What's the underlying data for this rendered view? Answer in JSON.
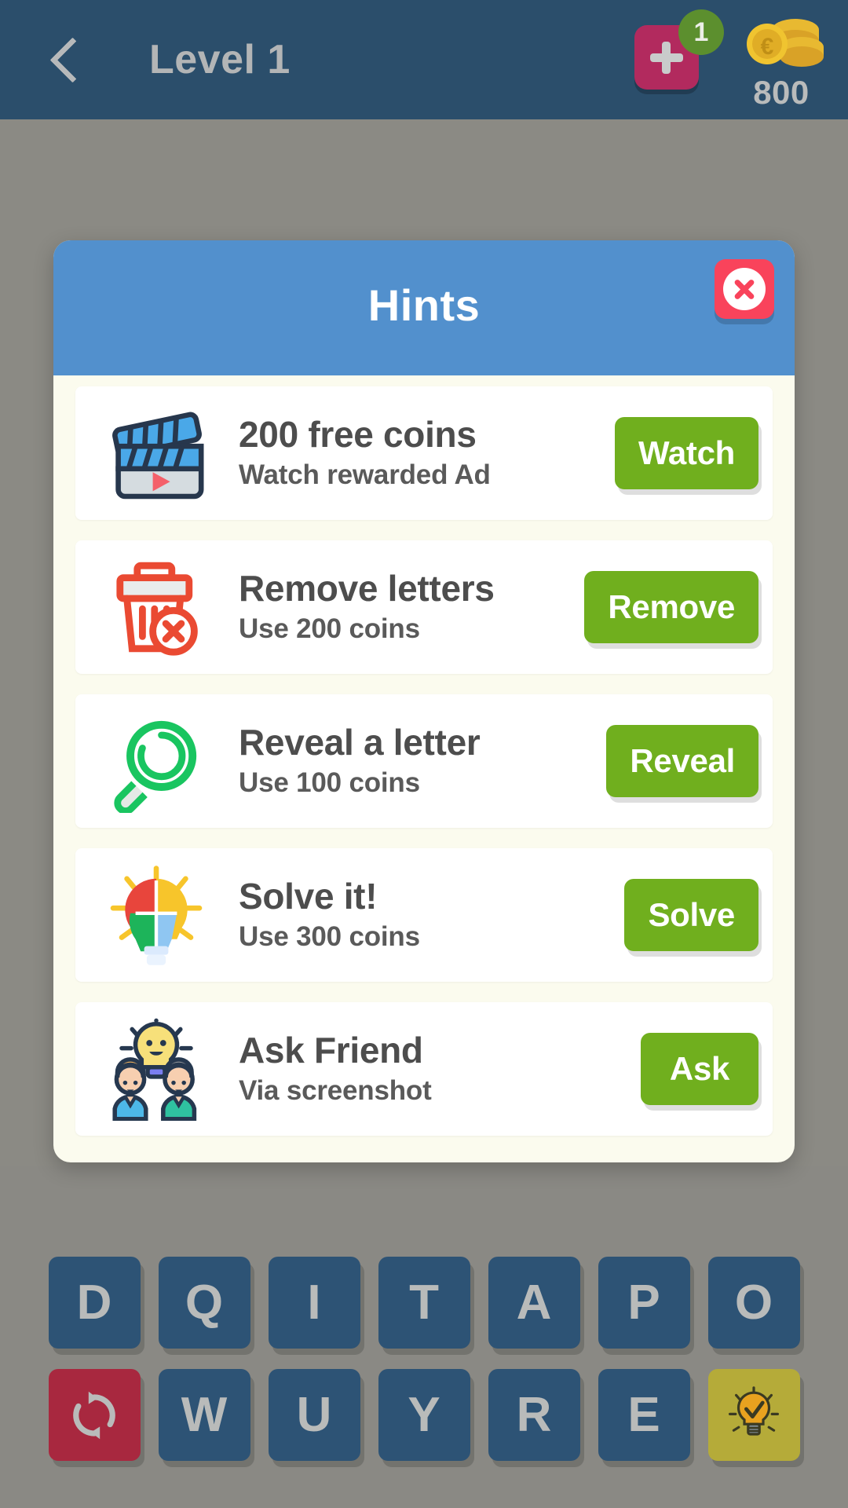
{
  "topbar": {
    "back_icon": "chevron-left-icon",
    "level_title": "Level 1",
    "plus_icon": "plus-icon",
    "plus_badge": "1",
    "coin_icon": "coin-stack-icon",
    "coin_amount": "800",
    "bar_color": "#2b4e6b"
  },
  "dialog": {
    "title": "Hints",
    "close_icon": "close-x-icon",
    "header_color": "#5290cd",
    "body_color": "#fbfbee",
    "hints": [
      {
        "icon": "clapperboard-video-icon",
        "title": "200 free coins",
        "subtitle": "Watch rewarded Ad",
        "button": "Watch"
      },
      {
        "icon": "trash-remove-icon",
        "title": "Remove letters",
        "subtitle": "Use 200 coins",
        "button": "Remove"
      },
      {
        "icon": "magnifier-reveal-icon",
        "title": "Reveal a letter",
        "subtitle": "Use 100 coins",
        "button": "Reveal"
      },
      {
        "icon": "puzzle-lightbulb-icon",
        "title": "Solve it!",
        "subtitle": "Use 300 coins",
        "button": "Solve"
      },
      {
        "icon": "friends-lightbulb-icon",
        "title": "Ask Friend",
        "subtitle": "Via screenshot",
        "button": "Ask"
      }
    ],
    "button_color": "#70af1e"
  },
  "keyboard": {
    "row1": [
      "D",
      "Q",
      "I",
      "T",
      "A",
      "P",
      "O"
    ],
    "row2_letters": [
      "W",
      "U",
      "Y",
      "R",
      "E"
    ],
    "shuffle_icon": "shuffle-refresh-icon",
    "hint_icon": "lightbulb-check-icon",
    "key_color": "#2d5375",
    "shuffle_color": "#a8283f",
    "hint_key_color": "#b5ab39"
  }
}
